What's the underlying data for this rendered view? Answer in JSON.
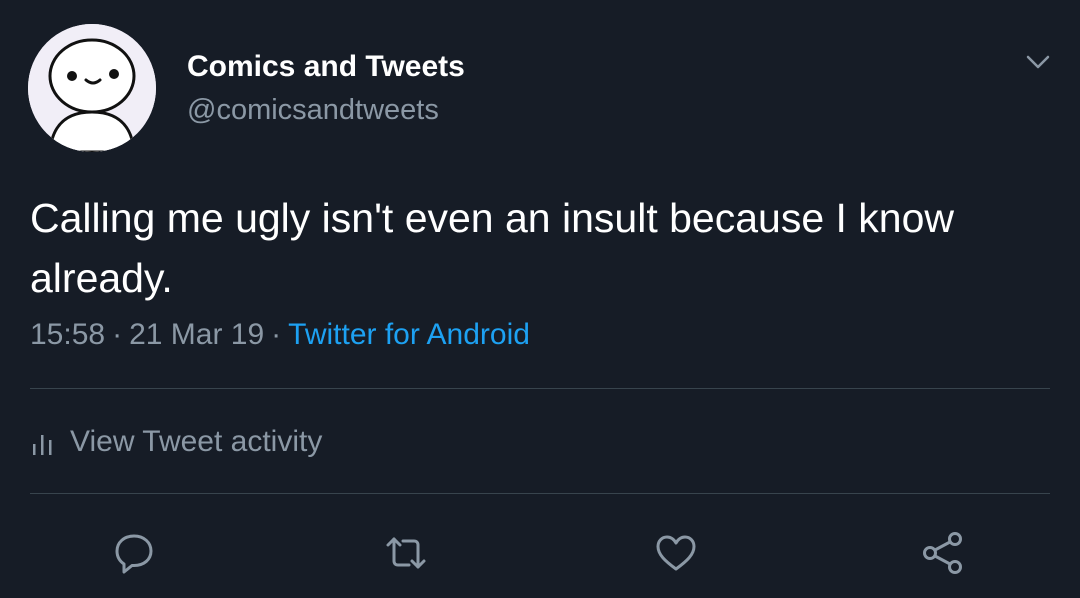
{
  "user": {
    "display_name": "Comics and Tweets",
    "handle": "@comicsandtweets",
    "avatar_icon": "cartoon-face-avatar"
  },
  "tweet": {
    "text": "Calling me ugly isn't even an insult because I know already.",
    "time": "15:58",
    "separator": "·",
    "date": "21 Mar 19",
    "source": "Twitter for Android"
  },
  "activity": {
    "label": "View Tweet activity",
    "icon": "bar-chart-icon"
  },
  "actions": {
    "reply_icon": "reply-icon",
    "retweet_icon": "retweet-icon",
    "like_icon": "heart-icon",
    "share_icon": "share-icon",
    "menu_icon": "chevron-down-icon"
  },
  "colors": {
    "background": "#161c26",
    "text_primary": "#ffffff",
    "text_secondary": "#8b98a5",
    "link": "#1da1f2",
    "divider": "#38444d",
    "icon": "#8b98a5"
  }
}
